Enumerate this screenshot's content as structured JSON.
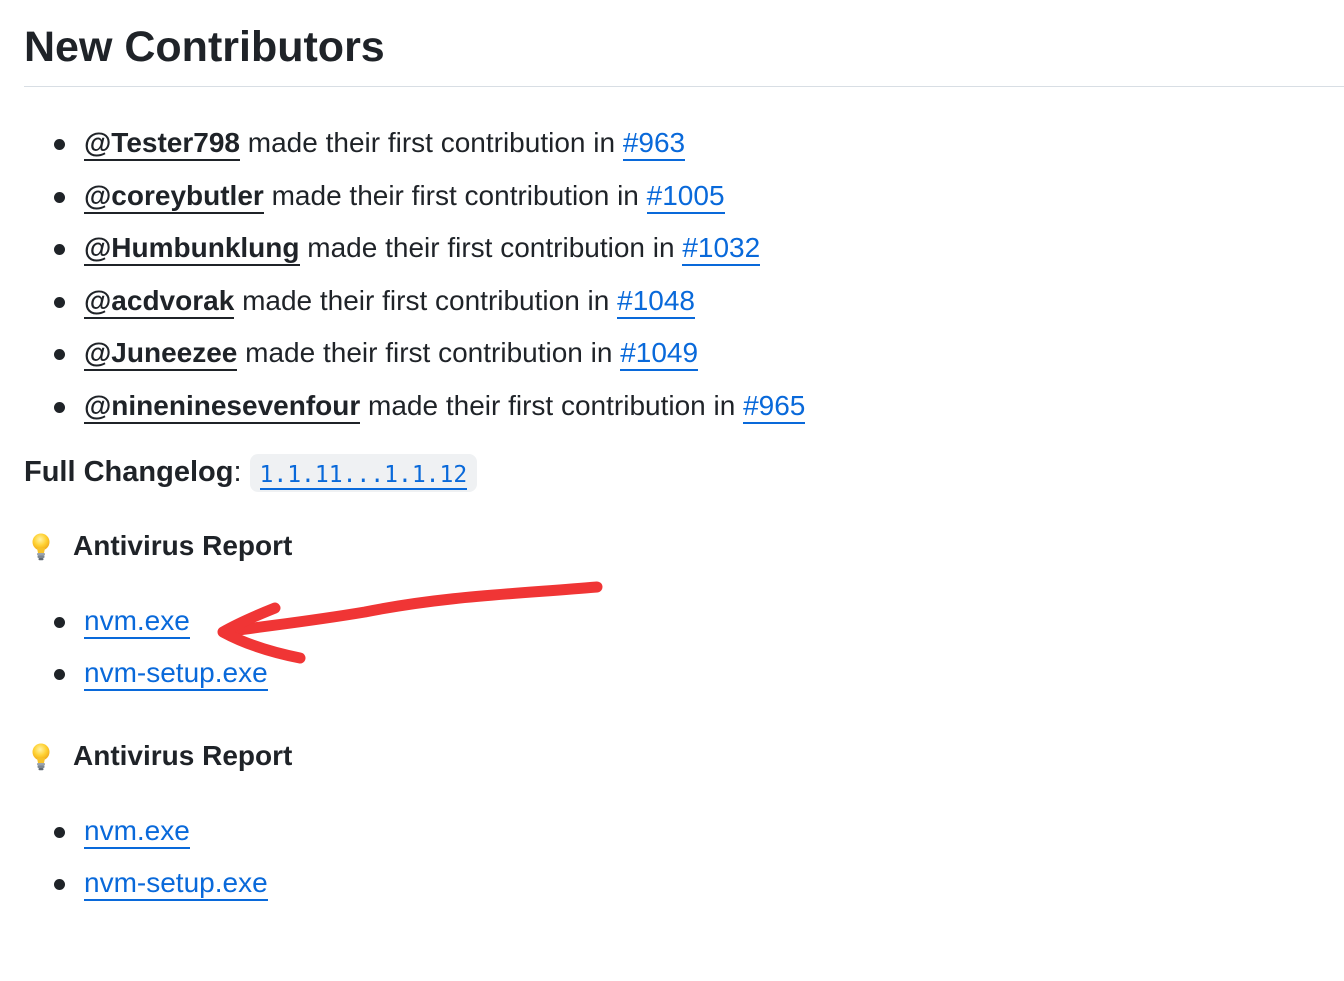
{
  "title": "New Contributors",
  "contribution_phrase": "made their first contribution in",
  "contributors": [
    {
      "user": "@Tester798",
      "pr": "#963"
    },
    {
      "user": "@coreybutler",
      "pr": "#1005"
    },
    {
      "user": "@Humbunklung",
      "pr": "#1032"
    },
    {
      "user": "@acdvorak",
      "pr": "#1048"
    },
    {
      "user": "@Juneezee",
      "pr": "#1049"
    },
    {
      "user": "@nineninesevenfour",
      "pr": "#965"
    }
  ],
  "changelog": {
    "label": "Full Changelog",
    "separator": ":",
    "range": "1.1.11...1.1.12"
  },
  "antivirus_sections": [
    {
      "icon": "lightbulb-icon",
      "heading": "Antivirus Report",
      "files": [
        "nvm.exe",
        "nvm-setup.exe"
      ]
    },
    {
      "icon": "lightbulb-icon",
      "heading": "Antivirus Report",
      "files": [
        "nvm.exe",
        "nvm-setup.exe"
      ]
    }
  ],
  "colors": {
    "text": "#1f2328",
    "link": "#0969da",
    "annotation_arrow": "#f03535",
    "code_background": "#eff1f3",
    "divider": "#d8dee4"
  }
}
